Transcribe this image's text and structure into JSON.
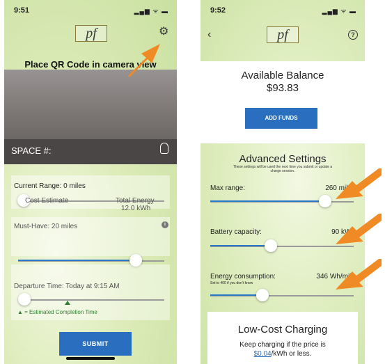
{
  "screen1": {
    "status_time": "9:51",
    "status_icons": "▂▄▆ ᯤ ▬",
    "logo": "pf",
    "qr_title": "Place QR Code in camera view",
    "space_label": "SPACE #:",
    "current_range": "Current Range: 0 miles",
    "current_range_value": 0,
    "cost_estimate_label": "Cost Estimate",
    "total_energy_label": "Total Energy",
    "total_energy_value": "12.0 kWh",
    "must_have_label": "Must-Have: 20 miles",
    "must_have_fraction": 0.84,
    "info_icon_text": "i",
    "departure_label": "Departure Time: Today at 9:15 AM",
    "estimated_completion": "▲ = Estimated Completion Time",
    "submit_label": "SUBMIT",
    "gear_icon": "⚙"
  },
  "screen2": {
    "status_time": "9:52",
    "status_icons": "▂▄▆ ᯤ ▬",
    "back_icon": "‹",
    "logo": "pf",
    "help_icon": "?",
    "balance_title": "Available Balance",
    "balance_value": "$93.83",
    "add_funds_label": "ADD FUNDS",
    "advanced_title": "Advanced Settings",
    "advanced_note": "These settings will be used the next time you submit or update a charge session.",
    "max_range_label": "Max range:",
    "max_range_value": "260 miles",
    "max_range_fraction": 0.9,
    "battery_label": "Battery capacity:",
    "battery_value": "90 kWh",
    "battery_fraction": 0.45,
    "energy_label": "Energy consumption:",
    "energy_sublabel": "Set to 400 if you don't know",
    "energy_value": "346 Wh/mile",
    "energy_fraction": 0.4,
    "low_cost_title": "Low-Cost Charging",
    "low_cost_line1": "Keep charging if the price is",
    "low_cost_price": "$0.04",
    "low_cost_line2_suffix": "/kWh or less."
  },
  "colors": {
    "accent": "#2a6fbf",
    "slider_fill": "#2a79c9",
    "annotation_arrow": "#f08a24",
    "completion_marker": "#2f7d2f"
  }
}
